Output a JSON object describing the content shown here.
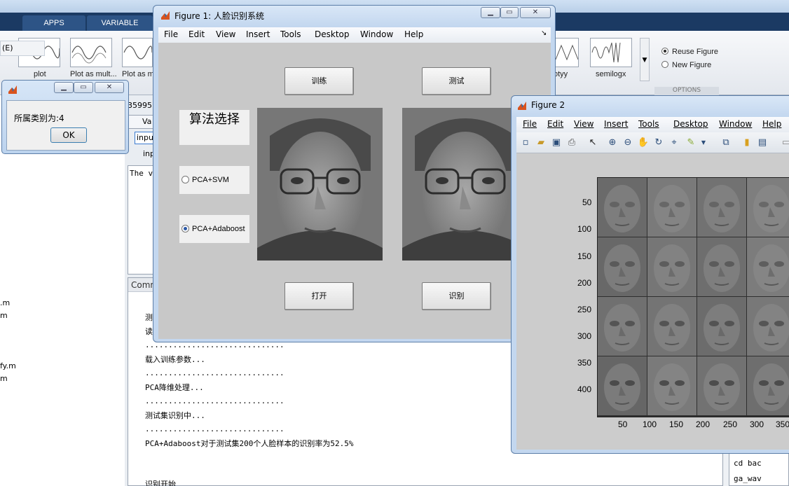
{
  "desktop": {
    "tabs": [
      "APPS",
      "VARIABLE"
    ],
    "left_label": "(E)",
    "plot_captions": [
      "plot",
      "Plot as mult...",
      "Plot as m",
      "otyy",
      "semilogx"
    ],
    "reuse_figure": "Reuse Figure",
    "new_figure": "New Figure",
    "options_caption": "OPTIONS",
    "var_value": "35995",
    "var_tab": "Va",
    "input_box": "inpu",
    "input_label": "inp",
    "the_v": "The v",
    "cmd_tab": "Comm",
    "files": [
      ".m",
      "m",
      "fy.m",
      "m"
    ],
    "cmd_lines": [
      "测",
      "读",
      "..............................",
      "载入训练参数...",
      "..............................",
      "PCA降维处理...",
      "..............................",
      "测试集识别中...",
      "..............................",
      "PCA+Adaboost对于测试集200个人脸样本的识别率为52.5%",
      "识别开始"
    ],
    "right_code": [
      "cd bac",
      "ga_wav"
    ]
  },
  "msgbox": {
    "message": "所属类别为:4",
    "ok": "OK"
  },
  "figure1": {
    "title": "Figure 1: 人脸识别系统",
    "menus": [
      "File",
      "Edit",
      "View",
      "Insert",
      "Tools",
      "Desktop",
      "Window",
      "Help"
    ],
    "btn_train": "训练",
    "btn_test": "测试",
    "btn_open": "打开",
    "btn_recognize": "识别",
    "algo_title": "算法选择",
    "radio_svm": "PCA+SVM",
    "radio_adaboost": "PCA+Adaboost",
    "selected": "PCA+Adaboost"
  },
  "figure2": {
    "title": "Figure 2",
    "menus": [
      "File",
      "Edit",
      "View",
      "Insert",
      "Tools",
      "Desktop",
      "Window",
      "Help"
    ],
    "y_ticks": [
      "50",
      "100",
      "150",
      "200",
      "250",
      "300",
      "350",
      "400"
    ],
    "x_ticks": [
      "50",
      "100",
      "150",
      "200",
      "250",
      "300",
      "350"
    ]
  },
  "colors": {
    "ribbon_dark": "#1b3a63",
    "figure_bg": "#c8c8c8",
    "title_blue": "#c3d7ef"
  }
}
